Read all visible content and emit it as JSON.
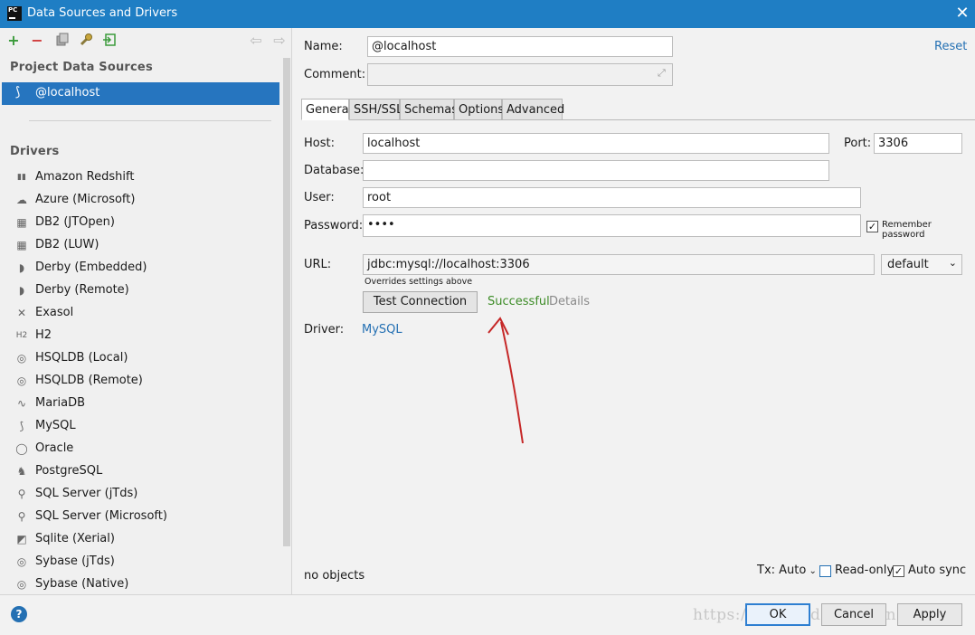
{
  "window": {
    "title": "Data Sources and Drivers",
    "app_icon": "PC",
    "close_icon": "close-icon"
  },
  "toolbar": {
    "icons": [
      "add-icon",
      "remove-icon",
      "duplicate-icon",
      "properties-icon",
      "import-icon",
      "back-icon",
      "forward-icon"
    ],
    "add_glyph": "+",
    "remove_glyph": "−",
    "back_glyph": "⇦",
    "forward_glyph": "⇨"
  },
  "left": {
    "project_title": "Project Data Sources",
    "selected_source": "@localhost",
    "drivers_title": "Drivers",
    "drivers": [
      {
        "label": "Amazon Redshift",
        "icon": "amazon-redshift-icon",
        "glyph": "▮▮"
      },
      {
        "label": "Azure (Microsoft)",
        "icon": "azure-icon",
        "glyph": "☁"
      },
      {
        "label": "DB2 (JTOpen)",
        "icon": "db2-icon",
        "glyph": "▦"
      },
      {
        "label": "DB2 (LUW)",
        "icon": "db2-icon",
        "glyph": "▦"
      },
      {
        "label": "Derby (Embedded)",
        "icon": "derby-icon",
        "glyph": "◗"
      },
      {
        "label": "Derby (Remote)",
        "icon": "derby-icon",
        "glyph": "◗"
      },
      {
        "label": "Exasol",
        "icon": "exasol-icon",
        "glyph": "✕"
      },
      {
        "label": "H2",
        "icon": "h2-icon",
        "glyph": "H2"
      },
      {
        "label": "HSQLDB (Local)",
        "icon": "hsqldb-icon",
        "glyph": "◎"
      },
      {
        "label": "HSQLDB (Remote)",
        "icon": "hsqldb-icon",
        "glyph": "◎"
      },
      {
        "label": "MariaDB",
        "icon": "mariadb-icon",
        "glyph": "∿"
      },
      {
        "label": "MySQL",
        "icon": "mysql-icon",
        "glyph": "⟆"
      },
      {
        "label": "Oracle",
        "icon": "oracle-icon",
        "glyph": "◯"
      },
      {
        "label": "PostgreSQL",
        "icon": "postgresql-icon",
        "glyph": "♞"
      },
      {
        "label": "SQL Server (jTds)",
        "icon": "sqlserver-icon",
        "glyph": "⚲"
      },
      {
        "label": "SQL Server (Microsoft)",
        "icon": "sqlserver-icon",
        "glyph": "⚲"
      },
      {
        "label": "Sqlite (Xerial)",
        "icon": "sqlite-icon",
        "glyph": "◩"
      },
      {
        "label": "Sybase (jTds)",
        "icon": "sybase-icon",
        "glyph": "◎"
      },
      {
        "label": "Sybase (Native)",
        "icon": "sybase-icon",
        "glyph": "◎"
      }
    ]
  },
  "form": {
    "name_label": "Name:",
    "name_value": "@localhost",
    "comment_label": "Comment:",
    "comment_value": "",
    "reset_label": "Reset",
    "tabs": [
      "General",
      "SSH/SSL",
      "Schemas",
      "Options",
      "Advanced"
    ],
    "active_tab": "General",
    "host_label": "Host:",
    "host_value": "localhost",
    "port_label": "Port:",
    "port_value": "3306",
    "database_label": "Database:",
    "database_value": "",
    "user_label": "User:",
    "user_value": "root",
    "password_label": "Password:",
    "password_value": "••••",
    "remember_password_label": "Remember password",
    "remember_password_checked": true,
    "url_label": "URL:",
    "url_value": "jdbc:mysql://localhost:3306",
    "url_hint": "Overrides settings above",
    "url_mode": "default",
    "test_button": "Test Connection",
    "status": "Successful",
    "details": "Details",
    "driver_label": "Driver:",
    "driver_value": "MySQL",
    "objects_text": "no objects",
    "tx_label": "Tx: Auto",
    "readonly_label": "Read-only",
    "readonly_checked": false,
    "autosync_label": "Auto sync",
    "autosync_checked": true
  },
  "buttons": {
    "ok": "OK",
    "cancel": "Cancel",
    "apply": "Apply",
    "help": "?"
  },
  "watermark": "https://blog.csdn.net/ronaldw",
  "colors": {
    "titlebar": "#1f7ec4",
    "selection": "#2675bf",
    "success": "#3d8c27",
    "link": "#2470b3",
    "arrow": "#c62828"
  }
}
